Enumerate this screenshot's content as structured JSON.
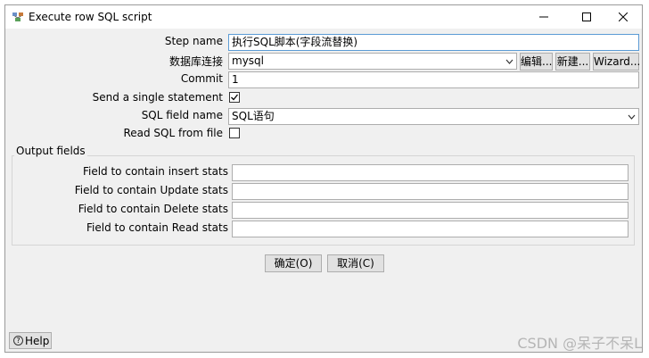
{
  "window": {
    "title": "Execute row SQL script",
    "controls": {
      "minimize": "minimize",
      "maximize": "maximize",
      "close": "close"
    }
  },
  "form": {
    "step_name_label": "Step name",
    "step_name_value": "执行SQL脚本(字段流替换)",
    "connection_label": "数据库连接",
    "connection_value": "mysql",
    "edit_button": "编辑...",
    "new_button": "新建...",
    "wizard_button": "Wizard...",
    "commit_label": "Commit",
    "commit_value": "1",
    "single_statement_label": "Send a single statement",
    "single_statement_checked": true,
    "sql_field_label": "SQL field name",
    "sql_field_value": "SQL语句",
    "read_sql_label": "Read SQL from file",
    "read_sql_checked": false
  },
  "output_fields": {
    "group_title": "Output fields",
    "insert_label": "Field to contain insert stats",
    "update_label": "Field to contain Update stats",
    "delete_label": "Field to contain Delete stats",
    "read_label": "Field to contain Read stats",
    "insert_value": "",
    "update_value": "",
    "delete_value": "",
    "read_value": ""
  },
  "actions": {
    "ok_button": "确定(O)",
    "cancel_button": "取消(C)",
    "help_button": "Help"
  },
  "watermark": "CSDN @呆子不呆L"
}
